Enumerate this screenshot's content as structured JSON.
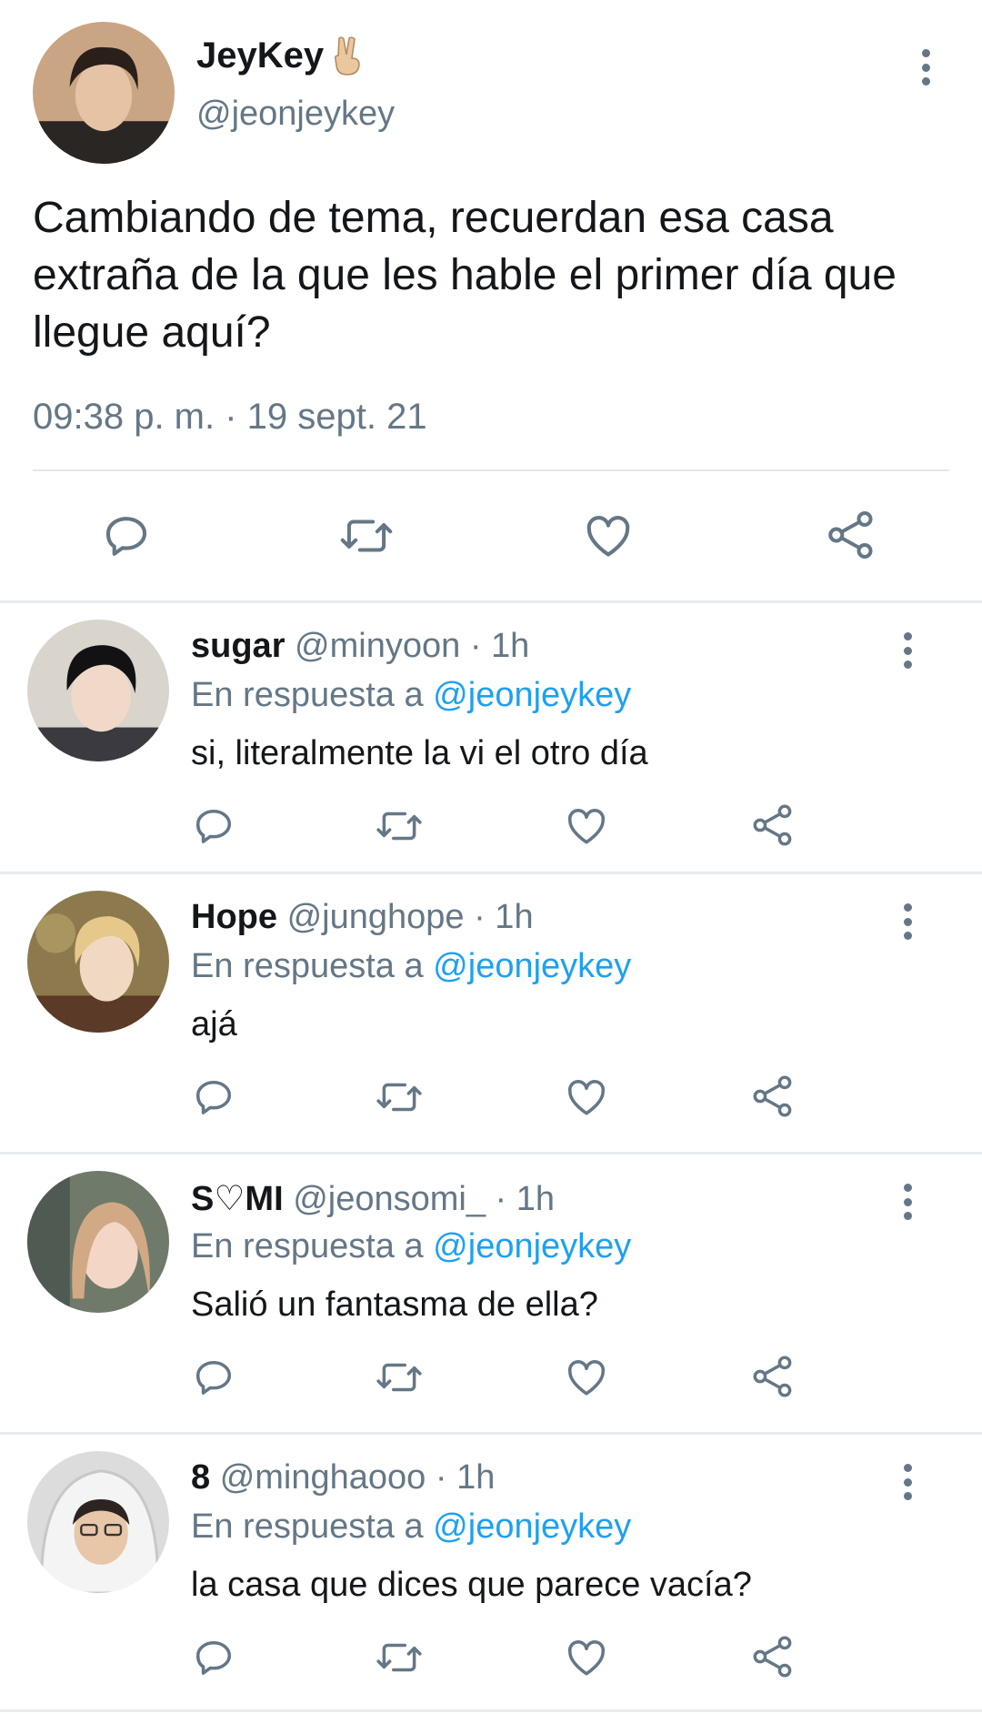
{
  "main_tweet": {
    "name": "JeyKey",
    "handle": "@jeonjeykey",
    "text": "Cambiando de tema, recuerdan esa casa extraña de la que les hable el primer día que llegue aquí?",
    "timestamp": "09:38 p. m. · 19 sept. 21"
  },
  "replies": [
    {
      "name": "sugar",
      "handle": "@minyoon",
      "time": "· 1h",
      "reply_prefix": "En respuesta a",
      "reply_to": "@jeonjeykey",
      "text": "si, literalmente la vi el otro día"
    },
    {
      "name": "Hope",
      "handle": "@junghope",
      "time": "· 1h",
      "reply_prefix": "En respuesta a",
      "reply_to": "@jeonjeykey",
      "text": "ajá"
    },
    {
      "name": "S♡MI",
      "handle": "@jeonsomi_",
      "time": "· 1h",
      "reply_prefix": "En respuesta a",
      "reply_to": "@jeonjeykey",
      "text": "Salió un fantasma de ella?"
    },
    {
      "name": "8",
      "handle": "@minghaooo",
      "time": "· 1h",
      "reply_prefix": "En respuesta a",
      "reply_to": "@jeonjeykey",
      "text": "la casa que dices que parece vacía?"
    }
  ],
  "icons": {
    "reply": "speech-bubble-icon",
    "retweet": "retweet-icon",
    "like": "heart-icon",
    "share": "share-icon",
    "more": "vertical-dots-icon"
  },
  "colors": {
    "text": "#14171a",
    "secondary": "#657786",
    "link": "#1da1f2",
    "divider": "#e6ecf0"
  }
}
